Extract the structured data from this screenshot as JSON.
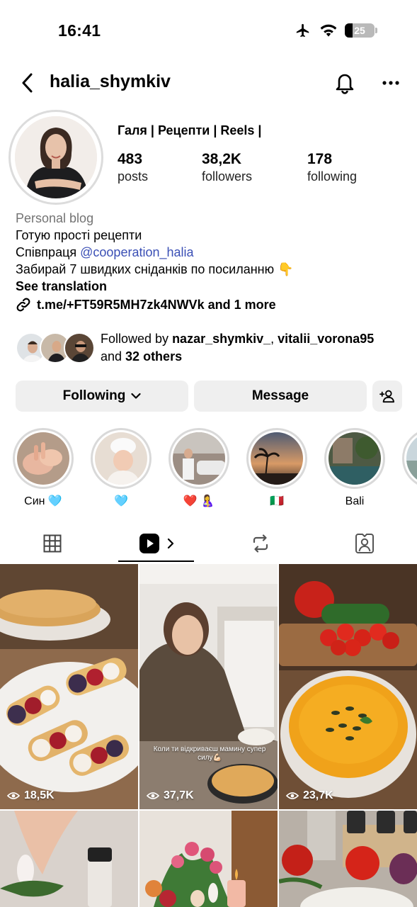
{
  "status_bar": {
    "time": "16:41",
    "battery_level": "25",
    "battery_fraction": 0.25
  },
  "header": {
    "username": "halia_shymkiv"
  },
  "profile": {
    "display_name": "Галя | Рецепти | Reels |",
    "stats": [
      {
        "value": "483",
        "label": "posts"
      },
      {
        "value": "38,2K",
        "label": "followers"
      },
      {
        "value": "178",
        "label": "following"
      }
    ]
  },
  "bio": {
    "category": "Personal blog",
    "line1": "Готую прості рецепти",
    "line2_prefix": "Співпраця ",
    "line2_mention": "@cooperation_halia",
    "line3": "Забирай 7 швидких сніданків по посиланню 👇",
    "see_translation": "See translation",
    "link": "t.me/+FT59R5MH7zk4NWVk and 1 more"
  },
  "followed_by": {
    "prefix": "Followed by ",
    "user1": "nazar_shymkiv_",
    "separator": ", ",
    "user2": "vitalii_vorona95",
    "line2_prefix": "and ",
    "others": "32 others"
  },
  "actions": {
    "following": "Following",
    "message": "Message"
  },
  "highlights": [
    {
      "label": "Син 🩵"
    },
    {
      "label": "🩵"
    },
    {
      "label": "❤️ 🤱"
    },
    {
      "label": "🇮🇹"
    },
    {
      "label": "Bali"
    },
    {
      "label": ""
    }
  ],
  "grid": [
    {
      "views": "18,5K"
    },
    {
      "views": "37,7K",
      "caption": "Коли ти відкриваєш мамину супер силу💪🏻"
    },
    {
      "views": "23,7K"
    }
  ],
  "colors": {
    "accent_link": "#3a4fb5",
    "button_bg": "#efefef",
    "secondary_text": "#737373"
  }
}
